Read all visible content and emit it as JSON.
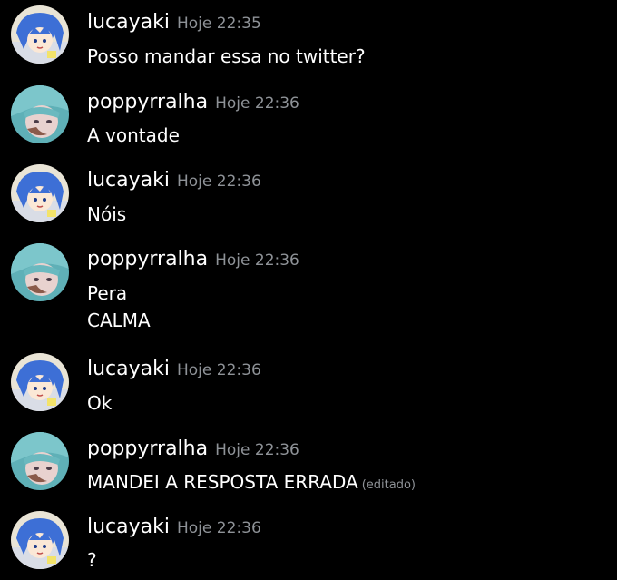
{
  "messages": [
    {
      "user": "lucayaki",
      "time": "Hoje 22:35",
      "lines": [
        "Posso mandar essa no twitter?"
      ]
    },
    {
      "user": "poppyrralha",
      "time": "Hoje 22:36",
      "lines": [
        "A vontade"
      ]
    },
    {
      "user": "lucayaki",
      "time": "Hoje 22:36",
      "lines": [
        "Nóis"
      ]
    },
    {
      "user": "poppyrralha",
      "time": "Hoje 22:36",
      "lines": [
        "Pera",
        "CALMA"
      ]
    },
    {
      "user": "lucayaki",
      "time": "Hoje 22:36",
      "lines": [
        "Ok"
      ]
    },
    {
      "user": "poppyrralha",
      "time": "Hoje 22:36",
      "lines": [
        "MANDEI A RESPOSTA ERRADA"
      ],
      "edited_label": "(editado)"
    },
    {
      "user": "lucayaki",
      "time": "Hoje 22:36",
      "lines": [
        "?"
      ]
    }
  ],
  "colors": {
    "background": "#000000",
    "username": "#ffffff",
    "timestamp": "#8e9297",
    "text": "#ffffff"
  }
}
